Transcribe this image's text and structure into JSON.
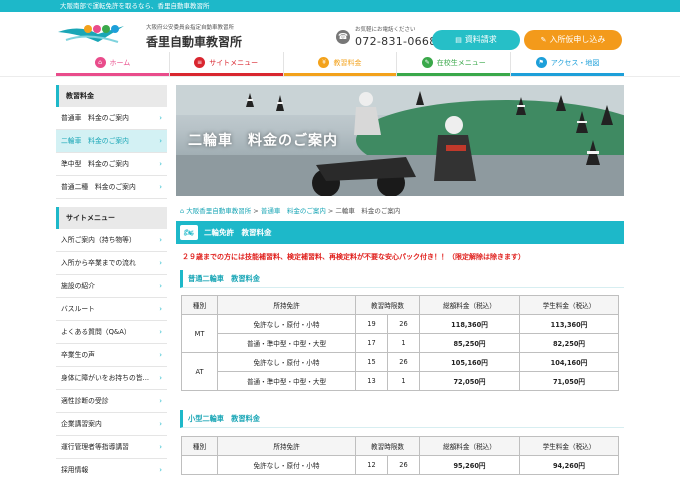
{
  "topbar": {
    "text": "大阪南部で運転免許を取るなら、香里自動車教習所"
  },
  "header": {
    "logo_sub": "大阪府公安委員会指定自動車教習所",
    "logo_name": "香里自動車教習所",
    "phone_label": "お気軽にお電話ください",
    "phone_number": "072-831-0668",
    "btn_request": "資料請求",
    "btn_apply": "入所仮申し込み",
    "colors": {
      "brand": "#1db8c9",
      "apply": "#f39a1b"
    }
  },
  "gnav": [
    {
      "label": "ホーム",
      "color": "#e94c8b",
      "icon": "home-icon"
    },
    {
      "label": "サイトメニュー",
      "color": "#d9262f",
      "icon": "menu-icon"
    },
    {
      "label": "教習料金",
      "color": "#f3a21b",
      "icon": "yen-icon"
    },
    {
      "label": "在校生メニュー",
      "color": "#3aa84a",
      "icon": "student-icon"
    },
    {
      "label": "アクセス・地図",
      "color": "#1d9fd9",
      "icon": "map-icon"
    }
  ],
  "sidebar": {
    "fees_heading": "教習料金",
    "fees_items": [
      {
        "label": "普通車　料金のご案内"
      },
      {
        "label": "二輪車　料金のご案内"
      },
      {
        "label": "準中型　料金のご案内"
      },
      {
        "label": "普通二種　料金のご案内"
      }
    ],
    "menu_heading": "サイトメニュー",
    "menu_items": [
      {
        "label": "入所ご案内（持ち物等）"
      },
      {
        "label": "入所から卒業までの流れ"
      },
      {
        "label": "施設の紹介"
      },
      {
        "label": "バスルート"
      },
      {
        "label": "よくある質問（Q&A）"
      },
      {
        "label": "卒業生の声"
      },
      {
        "label": "身体に障がいをお持ちの皆..."
      },
      {
        "label": "適性診断の受診"
      },
      {
        "label": "企業講習案内"
      },
      {
        "label": "運行管理者等指導講習"
      },
      {
        "label": "採用情報"
      }
    ]
  },
  "hero": {
    "title": "二輪車　料金のご案内"
  },
  "breadcrumb": {
    "home": "大阪香里自動車教習所",
    "parent": "普通車　料金のご案内",
    "current": "二輪車　料金のご案内",
    "sep": " > "
  },
  "section": {
    "title": "二輪免許　教習料金"
  },
  "notice": "２９歳までの方には技能補習料、検定補習料、再検定料が不要な安心パック付き！！（限定解除は除きます）",
  "table_headers": {
    "type": "種別",
    "license": "所持免許",
    "hours": "教習時限数",
    "total": "総額料金（税込）",
    "student": "学生料金（税込）"
  },
  "futsu": {
    "heading": "普通二輪車　教習料金",
    "groups": [
      {
        "type": "MT",
        "rows": [
          {
            "license": "免許なし・原付・小特",
            "h1": "19",
            "h2": "26",
            "total": "118,360円",
            "student": "113,360円"
          },
          {
            "license": "普通・準中型・中型・大型",
            "h1": "17",
            "h2": "1",
            "total": "85,250円",
            "student": "82,250円"
          }
        ]
      },
      {
        "type": "AT",
        "rows": [
          {
            "license": "免許なし・原付・小特",
            "h1": "15",
            "h2": "26",
            "total": "105,160円",
            "student": "104,160円"
          },
          {
            "license": "普通・準中型・中型・大型",
            "h1": "13",
            "h2": "1",
            "total": "72,050円",
            "student": "71,050円"
          }
        ]
      }
    ]
  },
  "kogata": {
    "heading": "小型二輪車　教習料金",
    "rows": [
      {
        "license": "免許なし・原付・小特",
        "h1": "12",
        "h2": "26",
        "total": "95,260円",
        "student": "94,260円"
      }
    ]
  }
}
